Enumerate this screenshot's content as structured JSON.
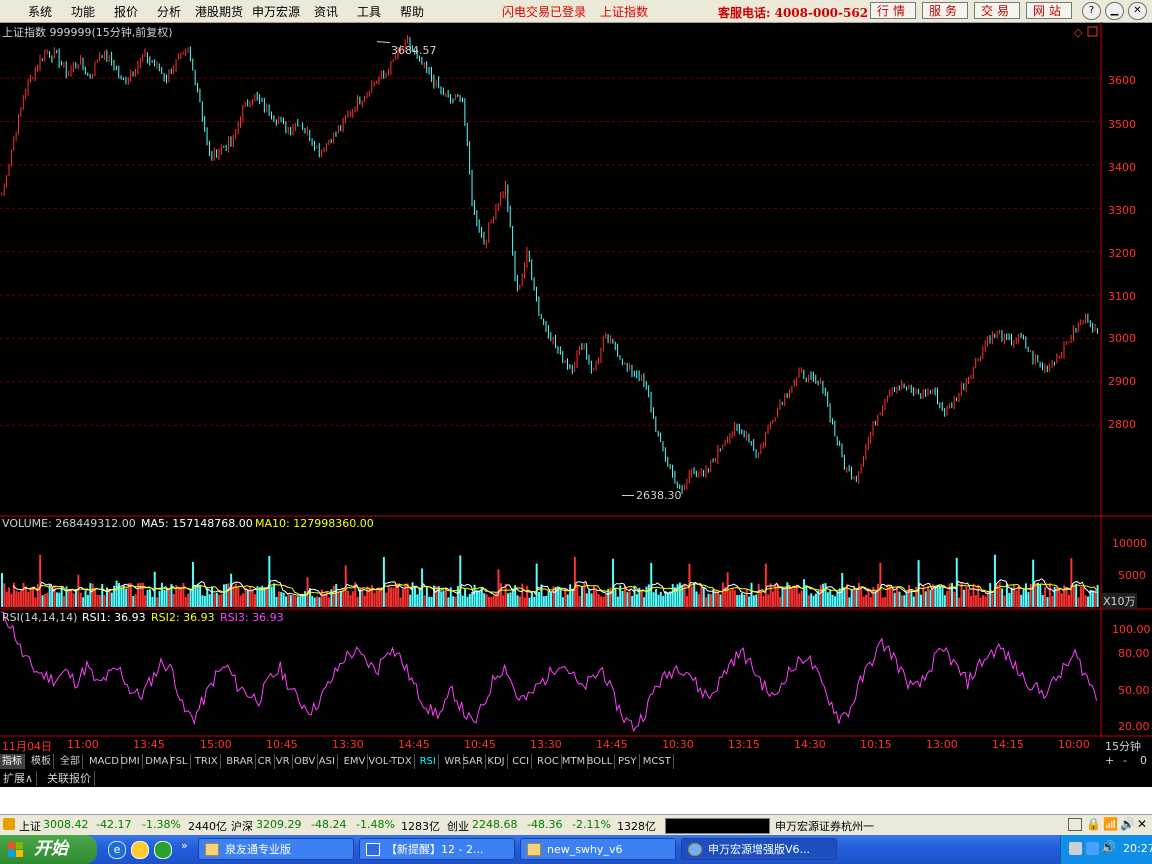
{
  "menu": {
    "items": [
      "系统",
      "功能",
      "报价",
      "分析",
      "港股期货",
      "申万宏源",
      "资讯",
      "工具",
      "帮助"
    ],
    "status": [
      "闪电交易已登录",
      "上证指数"
    ],
    "hotline": "客服电话: 4008-000-562",
    "buttons": [
      "行情",
      "服务",
      "交易",
      "网站"
    ]
  },
  "chart": {
    "title": "上证指数 999999(15分钟,前复权)",
    "high_label": "3684.57",
    "low_label": "2638.30",
    "price_ticks": [
      "3600",
      "3500",
      "3400",
      "3300",
      "3200",
      "3100",
      "3000",
      "2900",
      "2800"
    ],
    "volume_title": "VOLUME: 268449312.00",
    "volume_ma5": "MA5: 157148768.00",
    "volume_ma10": "MA10: 127998360.00",
    "volume_ticks": [
      "10000",
      "5000"
    ],
    "volume_unit": "X10万",
    "rsi_title": "RSI(14,14,14)",
    "rsi1": "RSI1: 36.93",
    "rsi2": "RSI2: 36.93",
    "rsi3": "RSI3: 36.93",
    "rsi_ticks": [
      "100.00",
      "80.00",
      "50.00",
      "20.00"
    ],
    "time_ticks": [
      "11月04日",
      "11:00",
      "13:45",
      "15:00",
      "10:45",
      "13:30",
      "14:45",
      "10:45",
      "13:30",
      "14:45",
      "10:30",
      "13:15",
      "14:30",
      "10:15",
      "13:00",
      "14:15",
      "10:00"
    ],
    "period": "15分钟",
    "colors": {
      "up": "#ff3232",
      "down": "#54ffff",
      "rsi": "#ff40ff",
      "axis": "#c00000",
      "ma5": "#ffffff",
      "ma10": "#ffff00"
    }
  },
  "chart_data": {
    "type": "candlestick",
    "title": "上证指数 999999(15分钟,前复权)",
    "ylim": [
      2600,
      3720
    ],
    "price_path": [
      3330,
      3450,
      3560,
      3620,
      3660,
      3650,
      3610,
      3640,
      3600,
      3660,
      3640,
      3590,
      3620,
      3650,
      3630,
      3600,
      3640,
      3660,
      3560,
      3410,
      3440,
      3450,
      3530,
      3560,
      3530,
      3510,
      3480,
      3500,
      3470,
      3430,
      3460,
      3490,
      3530,
      3560,
      3590,
      3610,
      3650,
      3684,
      3640,
      3610,
      3570,
      3550,
      3560,
      3300,
      3220,
      3300,
      3350,
      3100,
      3200,
      3060,
      3010,
      2960,
      2930,
      2990,
      2920,
      3000,
      2980,
      2930,
      2920,
      2870,
      2760,
      2700,
      2640,
      2700,
      2680,
      2720,
      2770,
      2790,
      2780,
      2730,
      2800,
      2850,
      2890,
      2920,
      2900,
      2890,
      2780,
      2700,
      2680,
      2760,
      2830,
      2880,
      2890,
      2880,
      2870,
      2880,
      2830,
      2860,
      2900,
      2950,
      3000,
      3010,
      2990,
      3000,
      2960,
      2930,
      2950,
      2980,
      3020,
      3050,
      3010
    ],
    "volume_ticks": [
      10000,
      5000
    ],
    "volume_unit": "X10万",
    "rsi_ylim": [
      15,
      100
    ],
    "rsi_ticks": [
      100,
      80,
      50,
      20
    ],
    "rsi_path": [
      100,
      90,
      70,
      60,
      55,
      52,
      58,
      50,
      62,
      48,
      55,
      60,
      45,
      40,
      52,
      65,
      58,
      30,
      25,
      40,
      55,
      62,
      48,
      42,
      38,
      52,
      60,
      45,
      35,
      30,
      42,
      55,
      68,
      72,
      65,
      58,
      75,
      70,
      55,
      40,
      30,
      28,
      45,
      30,
      20,
      35,
      55,
      62,
      40,
      38,
      48,
      55,
      65,
      58,
      45,
      52,
      60,
      40,
      25,
      18,
      30,
      48,
      55,
      62,
      58,
      45,
      40,
      52,
      65,
      72,
      60,
      48,
      38,
      55,
      62,
      70,
      55,
      40,
      25,
      30,
      50,
      65,
      78,
      70,
      55,
      45,
      52,
      68,
      72,
      60,
      50,
      62,
      70,
      75,
      65,
      55,
      48,
      42,
      50,
      60,
      70,
      55,
      40
    ]
  },
  "tabs": [
    "指标",
    "模板",
    "全部",
    "MACD",
    "DMI",
    "DMA",
    "FSL",
    "TRIX",
    "BRAR",
    "CR",
    "VR",
    "OBV",
    "ASI",
    "EMV",
    "VOL-TDX",
    "RSI",
    "WR",
    "SAR",
    "KDJ",
    "CCI",
    "ROC",
    "MTM",
    "BOLL",
    "PSY",
    "MCST"
  ],
  "tab_controls": [
    "+",
    "-",
    "0"
  ],
  "ext_tabs": [
    "扩展∧",
    "关联报价"
  ],
  "statusbar": {
    "sh_name": "上证",
    "sh_value": "3008.42",
    "sh_change": "-42.17",
    "sh_pct": "-1.38%",
    "sh_amount": "2440亿",
    "hs_name": "沪深",
    "hs_value": "3209.29",
    "hs_change": "-48.24",
    "hs_pct": "-1.48%",
    "hs_amount": "1283亿",
    "cy_name": "创业",
    "cy_value": "2248.68",
    "cy_change": "-48.36",
    "cy_pct": "-2.11%",
    "cy_amount": "1328亿",
    "broker": "申万宏源证券杭州一"
  },
  "taskbar": {
    "start": "开始",
    "tasks": [
      "泉友通专业版",
      "【新提醒】12 - 2...",
      "new_swhy_v6",
      "申万宏源增强版V6..."
    ],
    "clock": "20:27"
  }
}
